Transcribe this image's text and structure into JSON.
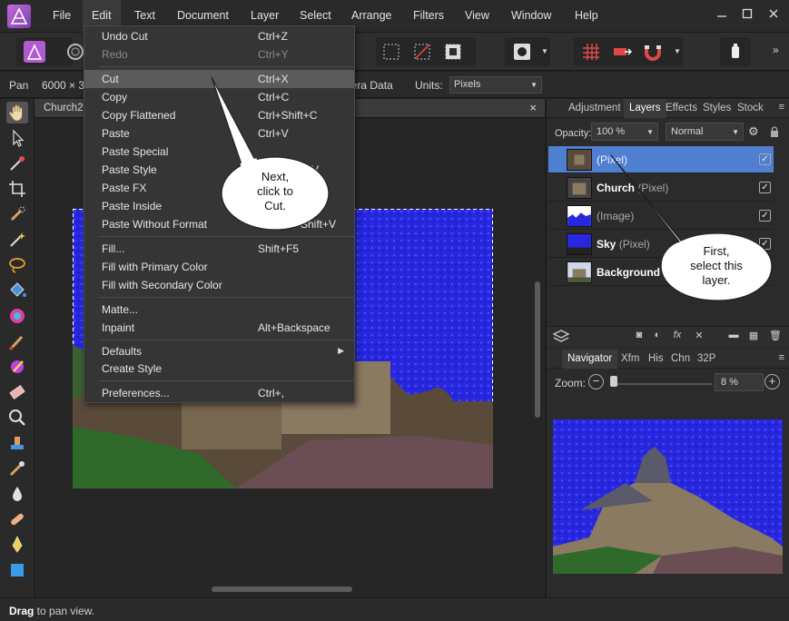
{
  "menubar": {
    "items": [
      "File",
      "Edit",
      "Text",
      "Document",
      "Layer",
      "Select",
      "Arrange",
      "Filters",
      "View",
      "Window",
      "Help"
    ],
    "active": "Edit"
  },
  "context": {
    "tool": "Pan",
    "size": "6000 × 3",
    "camera": "nera Data",
    "units_label": "Units:",
    "units_value": "Pixels"
  },
  "document": {
    "tab_title": "Church2",
    "close": "×"
  },
  "status": {
    "bold": "Drag",
    "rest": " to pan view."
  },
  "edit_menu": {
    "items": [
      {
        "label": "Undo Cut",
        "shortcut": "Ctrl+Z",
        "disabled": false
      },
      {
        "label": "Redo",
        "shortcut": "Ctrl+Y",
        "disabled": true
      },
      {
        "label": "Cut",
        "shortcut": "Ctrl+X",
        "highlighted": true
      },
      {
        "label": "Copy",
        "shortcut": "Ctrl+C"
      },
      {
        "label": "Copy Flattened",
        "shortcut": "Ctrl+Shift+C"
      },
      {
        "label": "Paste",
        "shortcut": "Ctrl+V"
      },
      {
        "label": "Paste Special",
        "shortcut": ""
      },
      {
        "label": "Paste Style",
        "shortcut": "V"
      },
      {
        "label": "Paste FX",
        "shortcut": ""
      },
      {
        "label": "Paste Inside",
        "shortcut": ""
      },
      {
        "label": "Paste Without Format",
        "shortcut": "Shift+V"
      },
      {
        "label": "Fill...",
        "shortcut": "Shift+F5"
      },
      {
        "label": "Fill with Primary Color",
        "shortcut": ""
      },
      {
        "label": "Fill with Secondary Color",
        "shortcut": ""
      },
      {
        "label": "Matte...",
        "shortcut": ""
      },
      {
        "label": "Inpaint",
        "shortcut": "Alt+Backspace"
      },
      {
        "label": "Defaults",
        "shortcut": "",
        "submenu": true
      },
      {
        "label": "Create Style",
        "shortcut": ""
      },
      {
        "label": "Preferences...",
        "shortcut": "Ctrl+,"
      }
    ]
  },
  "layers_panel": {
    "tabs": [
      "Adjustment",
      "Layers",
      "Effects",
      "Styles",
      "Stock"
    ],
    "active_tab": "Layers",
    "menu": "≡",
    "opacity_label": "Opacity:",
    "opacity_value": "100 %",
    "blend_mode": "Normal",
    "layers": [
      {
        "name": "",
        "type": "(Pixel)",
        "selected": true,
        "visible": true
      },
      {
        "name": "Church",
        "type": "(Pixel)",
        "selected": false,
        "visible": true
      },
      {
        "name": "",
        "type": "(Image)",
        "selected": false,
        "visible": true
      },
      {
        "name": "Sky",
        "type": "(Pixel)",
        "selected": false,
        "visible": true
      },
      {
        "name": "Background",
        "type": "",
        "selected": false,
        "visible": false
      }
    ]
  },
  "navigator_panel": {
    "tabs": [
      "Navigator",
      "Xfm",
      "His",
      "Chn",
      "32P"
    ],
    "active_tab": "Navigator",
    "menu": "≡",
    "zoom_label": "Zoom:",
    "zoom_value": "8 %",
    "zoom_minus": "−",
    "zoom_plus": "+"
  },
  "callouts": {
    "next": "Next,\nclick to\nCut.",
    "first": "First,\nselect this\nlayer."
  },
  "colors": {
    "accent_selection": "#4e7fd0",
    "sky_blue": "#2a2ae0",
    "menu_bg": "#353535"
  }
}
